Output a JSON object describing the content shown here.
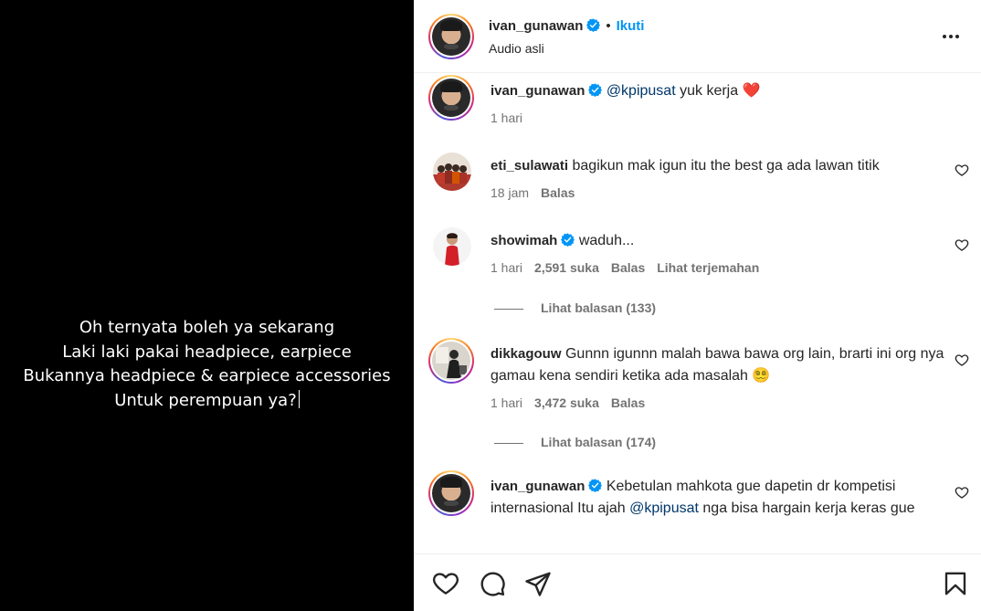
{
  "media": {
    "lines": [
      "Oh ternyata boleh ya sekarang",
      "Laki laki pakai headpiece, earpiece",
      "Bukannya headpiece & earpiece accessories",
      "Untuk perempuan ya?"
    ]
  },
  "header": {
    "username": "ivan_gunawan",
    "follow": "Ikuti",
    "audio": "Audio asli",
    "separator": "•"
  },
  "colors": {
    "link": "#0095f6",
    "verified": "#0095f6",
    "mention": "#00376b",
    "meta": "#737373",
    "heart": "#ed4956"
  },
  "comments": [
    {
      "username": "ivan_gunawan",
      "verified": true,
      "mention": "@kpipusat",
      "text": " yuk kerja ❤️",
      "time": "1 hari"
    },
    {
      "username": "eti_sulawati",
      "verified": false,
      "text": "bagikun mak igun itu the best ga ada lawan titik",
      "time": "18 jam",
      "reply": "Balas"
    },
    {
      "username": "showimah",
      "verified": true,
      "text": "waduh...",
      "time": "1 hari",
      "likes": "2,591 suka",
      "reply": "Balas",
      "translate": "Lihat terjemahan",
      "view_replies": "Lihat balasan (133)"
    },
    {
      "username": "dikkagouw",
      "verified": false,
      "text": "Gunnn igunnn malah bawa bawa org lain, brarti ini org nya gamau kena sendiri ketika ada masalah 😵‍💫",
      "time": "1 hari",
      "likes": "3,472 suka",
      "reply": "Balas",
      "view_replies": "Lihat balasan (174)"
    },
    {
      "username": "ivan_gunawan",
      "verified": true,
      "text_a": "Kebetulan mahkota gue dapetin dr kompetisi internasional Itu ajah ",
      "mention": "@kpipusat",
      "text_b": " nga bisa hargain kerja keras gue"
    }
  ],
  "icons": [
    "more-options-icon",
    "verified-badge-icon",
    "heart-outline-icon",
    "comment-icon",
    "share-icon",
    "bookmark-icon"
  ]
}
